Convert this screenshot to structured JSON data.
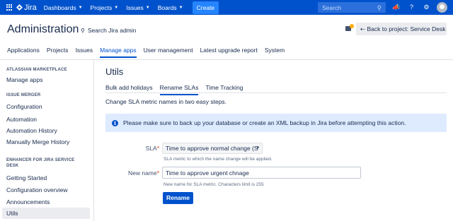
{
  "topbar": {
    "logo_text": "Jira",
    "nav": [
      {
        "label": "Dashboards",
        "chevron": "chevron-down-icon"
      },
      {
        "label": "Projects",
        "chevron": "chevron-down-icon"
      },
      {
        "label": "Issues",
        "chevron": "chevron-down-icon"
      },
      {
        "label": "Boards",
        "chevron": "chevron-down-icon"
      }
    ],
    "create_label": "Create",
    "search_placeholder": "Search",
    "icons": [
      "search-icon",
      "notifications-icon",
      "help-icon",
      "settings-icon",
      "avatar"
    ]
  },
  "admin": {
    "title": "Administration",
    "search_label": "Search Jira admin",
    "back_label": "Back to project: Service Desk",
    "tabs": [
      "Applications",
      "Projects",
      "Issues",
      "Manage apps",
      "User management",
      "Latest upgrade report",
      "System"
    ],
    "active_tab": "Manage apps"
  },
  "sidebar": {
    "sections": [
      {
        "heading": "ATLASSIAN MARKETPLACE",
        "items": [
          "Manage apps"
        ]
      },
      {
        "heading": "ISSUE MERGER",
        "items": [
          "Configuration",
          "Automation",
          "Automation History",
          "Manually Merge History"
        ]
      },
      {
        "heading": "ENHANCER FOR JIRA SERVICE DESK",
        "items": [
          "Getting Started",
          "Configuration overview",
          "Announcements",
          "Utils"
        ]
      }
    ],
    "active_item": "Utils"
  },
  "main": {
    "title": "Utils",
    "tabs": [
      "Bulk add holidays",
      "Rename SLAs",
      "Time Tracking"
    ],
    "active_tab": "Rename SLAs",
    "intro": "Change SLA metric names in two easy steps.",
    "info": "Please make sure to back up your database or create an XML backup in Jira before attempting this action.",
    "form": {
      "sla_label": "SLA",
      "sla_value": "Time to approve normal change (S",
      "sla_help": "SLA metric to which the name change will be applied.",
      "name_label": "New name",
      "name_value": "Time to approve urgent chnage",
      "name_help": "New name for SLA metric. Characters limit is 255",
      "required_mark": "*",
      "submit_label": "Rename"
    }
  },
  "colors": {
    "brand": "#0052cc",
    "info_bg": "#deebff",
    "required": "#de350b"
  }
}
